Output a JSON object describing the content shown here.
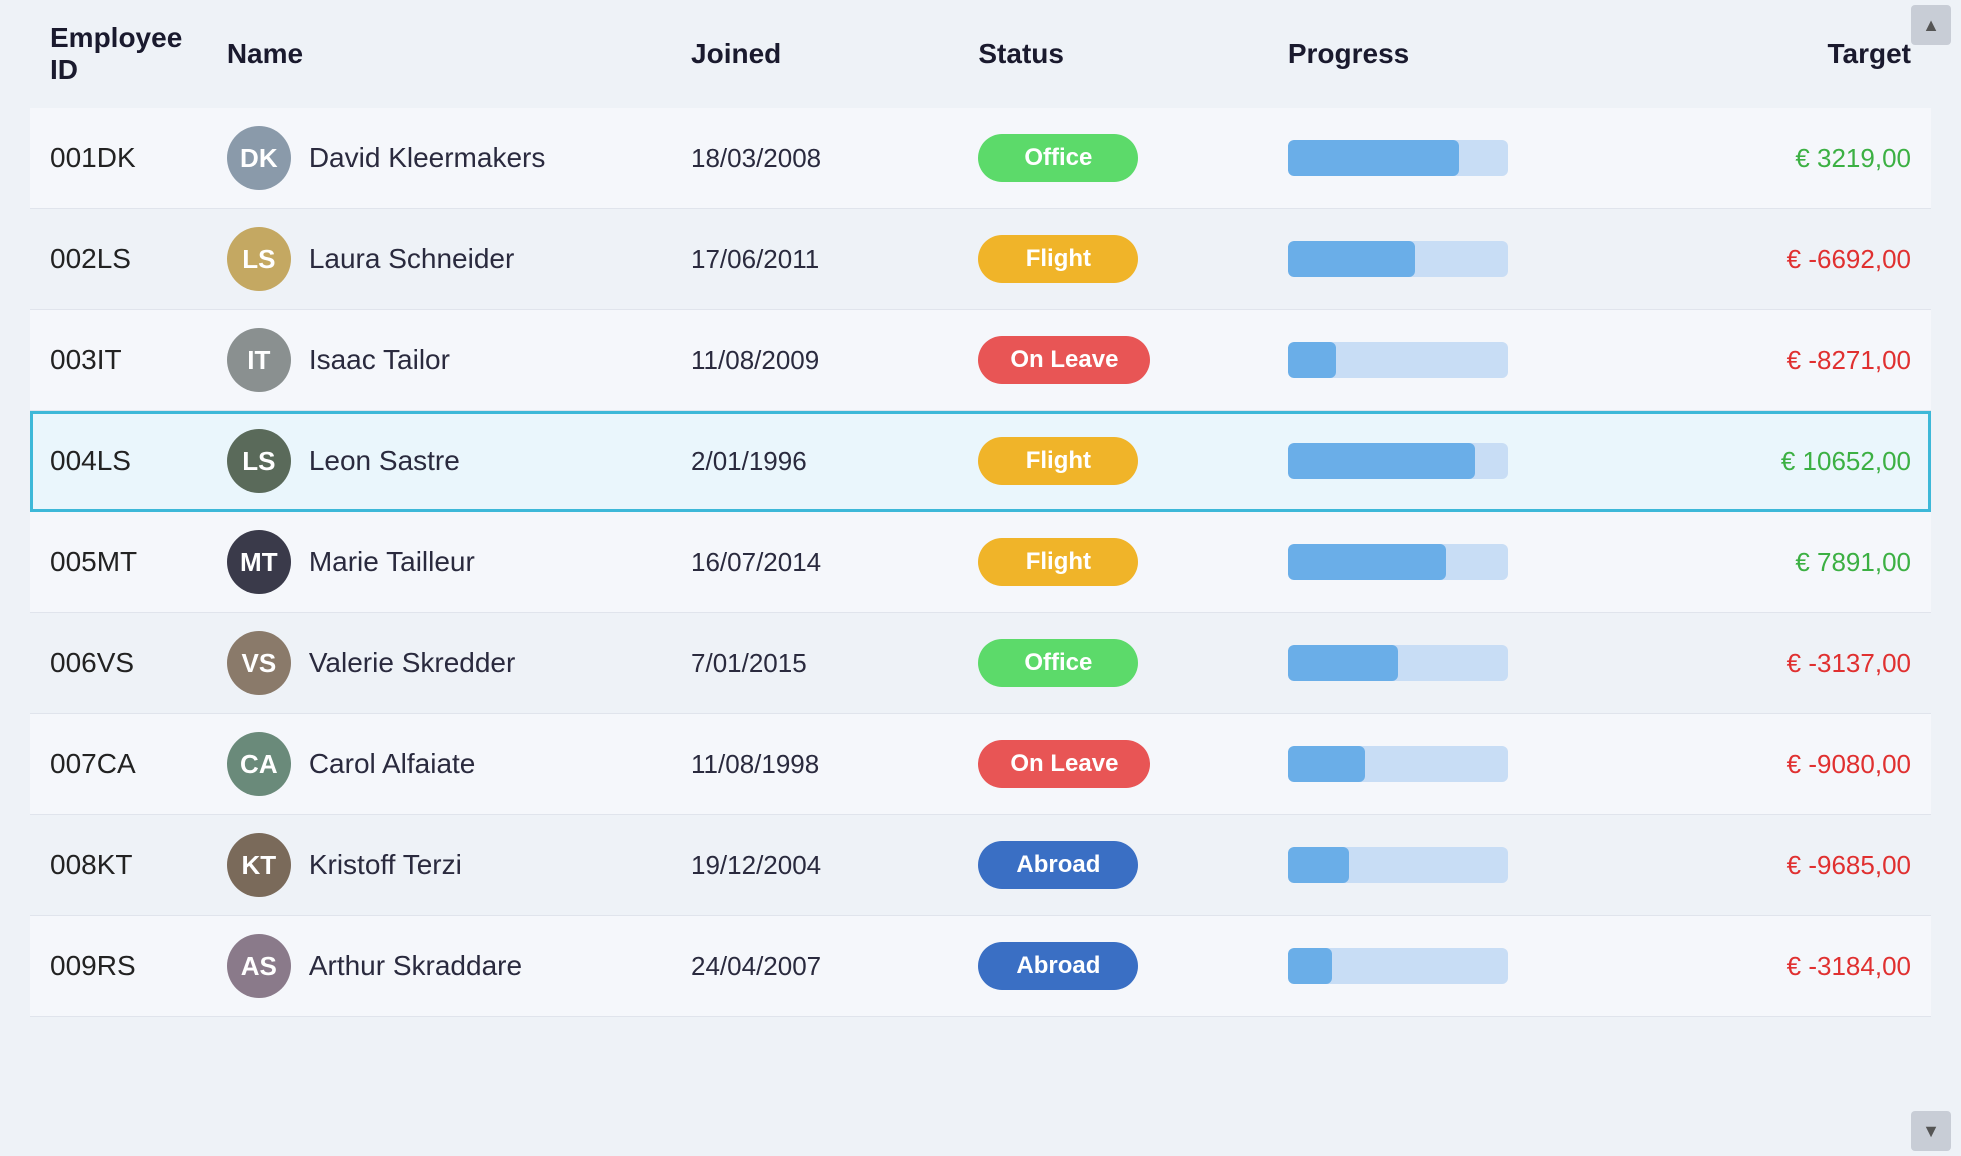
{
  "table": {
    "columns": {
      "id": "Employee ID",
      "name": "Name",
      "joined": "Joined",
      "status": "Status",
      "progress": "Progress",
      "target": "Target"
    },
    "rows": [
      {
        "id": "001DK",
        "name": "David Kleermakers",
        "initials": "DK",
        "avatarColor": "#8a9aaa",
        "joined": "18/03/2008",
        "status": "Office",
        "statusType": "office",
        "progressPct": 78,
        "target": "€ 3219,00",
        "targetType": "pos",
        "selected": false
      },
      {
        "id": "002LS",
        "name": "Laura Schneider",
        "initials": "LS",
        "avatarColor": "#c4a862",
        "joined": "17/06/2011",
        "status": "Flight",
        "statusType": "flight",
        "progressPct": 58,
        "target": "€ -6692,00",
        "targetType": "neg",
        "selected": false
      },
      {
        "id": "003IT",
        "name": "Isaac Tailor",
        "initials": "IT",
        "avatarColor": "#8a9090",
        "joined": "11/08/2009",
        "status": "On Leave",
        "statusType": "onleave",
        "progressPct": 22,
        "target": "€ -8271,00",
        "targetType": "neg",
        "selected": false
      },
      {
        "id": "004LS",
        "name": "Leon Sastre",
        "initials": "LS",
        "avatarColor": "#5a6a5a",
        "joined": "2/01/1996",
        "status": "Flight",
        "statusType": "flight",
        "progressPct": 85,
        "target": "€ 10652,00",
        "targetType": "pos",
        "selected": true
      },
      {
        "id": "005MT",
        "name": "Marie Tailleur",
        "initials": "MT",
        "avatarColor": "#3a3a4a",
        "joined": "16/07/2014",
        "status": "Flight",
        "statusType": "flight",
        "progressPct": 72,
        "target": "€ 7891,00",
        "targetType": "pos",
        "selected": false
      },
      {
        "id": "006VS",
        "name": "Valerie Skredder",
        "initials": "VS",
        "avatarColor": "#8a7a6a",
        "joined": "7/01/2015",
        "status": "Office",
        "statusType": "office",
        "progressPct": 50,
        "target": "€ -3137,00",
        "targetType": "neg",
        "selected": false
      },
      {
        "id": "007CA",
        "name": "Carol Alfaiate",
        "initials": "CA",
        "avatarColor": "#6a8a7a",
        "joined": "11/08/1998",
        "status": "On Leave",
        "statusType": "onleave",
        "progressPct": 35,
        "target": "€ -9080,00",
        "targetType": "neg",
        "selected": false
      },
      {
        "id": "008KT",
        "name": "Kristoff Terzi",
        "initials": "KT",
        "avatarColor": "#7a6a5a",
        "joined": "19/12/2004",
        "status": "Abroad",
        "statusType": "abroad",
        "progressPct": 28,
        "target": "€ -9685,00",
        "targetType": "neg",
        "selected": false
      },
      {
        "id": "009RS",
        "name": "Arthur Skraddare",
        "initials": "AS",
        "avatarColor": "#8a7a8a",
        "joined": "24/04/2007",
        "status": "Abroad",
        "statusType": "abroad",
        "progressPct": 20,
        "target": "€ -3184,00",
        "targetType": "neg",
        "selected": false
      }
    ],
    "scrollUpLabel": "▲",
    "scrollDownLabel": "▼"
  }
}
